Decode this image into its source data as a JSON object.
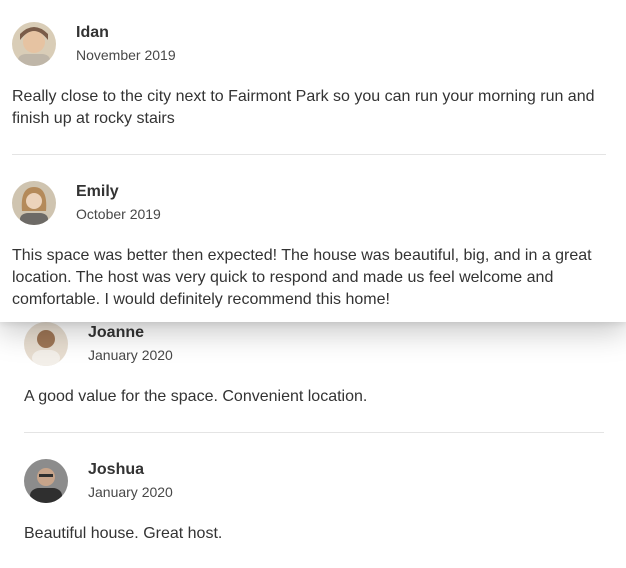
{
  "card_reviews": [
    {
      "name": "Idan",
      "date": "November 2019",
      "text": "Really close to the city next to Fairmont Park so you can run your morning run and finish up at rocky stairs",
      "avatar_colors": [
        "#d9cdb7",
        "#7a5c49"
      ]
    },
    {
      "name": "Emily",
      "date": "October 2019",
      "text": "This space was better then expected! The house was beautiful, big, and in a great location. The host was very quick to respond and made us feel welcome and comfortable. I would definitely recommend this home!",
      "avatar_colors": [
        "#cfc4b0",
        "#b48a5a"
      ]
    }
  ],
  "list_reviews": [
    {
      "name": "Joanne",
      "date": "January 2020",
      "text": "A good value for the space. Convenient location.",
      "avatar_colors": [
        "#e7ddd0",
        "#9e7656"
      ]
    },
    {
      "name": "Joshua",
      "date": "January 2020",
      "text": "Beautiful house. Great host.",
      "avatar_colors": [
        "#8c8c8c",
        "#2f2f2f"
      ]
    }
  ]
}
